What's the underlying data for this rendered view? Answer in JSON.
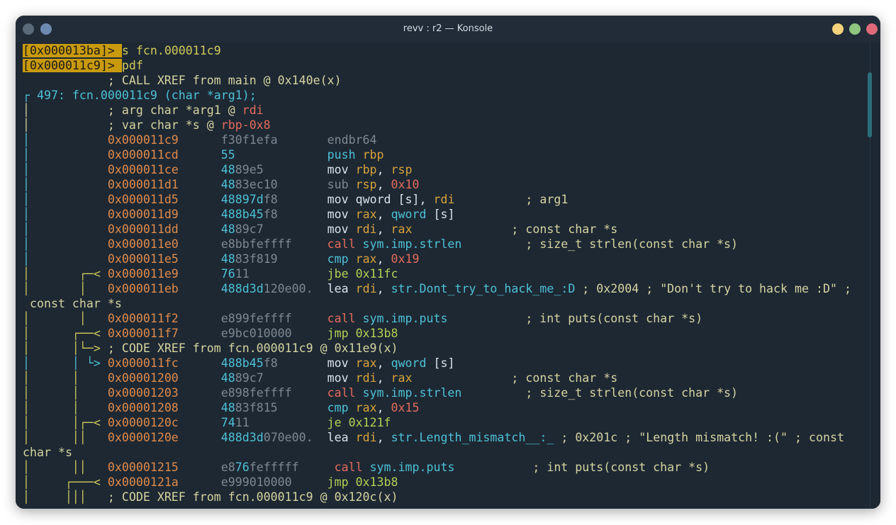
{
  "window": {
    "title": "revv : r2 — Konsole"
  },
  "colors": {
    "bg": "#1d2833",
    "prompt_bg": "#c99a0e",
    "addr": "#e08a4a",
    "cyan": "#4ec1d6",
    "yellow": "#d1c95a",
    "white": "#dbe3ea",
    "gray": "#7d8892",
    "red": "#e46a5a",
    "orange": "#d9a23a",
    "green": "#b5cf54",
    "blue": "#58a8e0",
    "comment": "#d6d4a0"
  },
  "lines": [
    [
      {
        "t": "[0x000013ba]> ",
        "c": "prompt"
      },
      {
        "t": "s fcn.000011c9",
        "c": "yellow"
      }
    ],
    [
      {
        "t": "[0x000011c9]> ",
        "c": "prompt"
      },
      {
        "t": "pdf",
        "c": "yellow"
      }
    ],
    [
      {
        "t": "            ; CALL XREF from main @ 0x140e(x)",
        "c": "comment"
      }
    ],
    [
      {
        "t": "┌ 497: fcn.000011c9 (char *arg1);",
        "c": "cyan"
      }
    ],
    [
      {
        "t": "│           ; arg char *arg1 @ ",
        "c": "comment"
      },
      {
        "t": "rdi",
        "c": "red"
      }
    ],
    [
      {
        "t": "│           ; var char *s @ ",
        "c": "comment"
      },
      {
        "t": "rbp-0x8",
        "c": "red"
      }
    ],
    [
      {
        "t": "│           ",
        "c": "cyan"
      },
      {
        "t": "0x000011c9",
        "c": "addr"
      },
      {
        "t": "      f30f1efa       ",
        "c": "gray"
      },
      {
        "t": "endbr64",
        "c": "gray"
      }
    ],
    [
      {
        "t": "│           ",
        "c": "cyan"
      },
      {
        "t": "0x000011cd",
        "c": "addr"
      },
      {
        "t": "      ",
        "c": "gray"
      },
      {
        "t": "55",
        "c": "cyan"
      },
      {
        "t": "             ",
        "c": "gray"
      },
      {
        "t": "push ",
        "c": "cyan"
      },
      {
        "t": "rbp",
        "c": "orange"
      }
    ],
    [
      {
        "t": "│           ",
        "c": "cyan"
      },
      {
        "t": "0x000011ce",
        "c": "addr"
      },
      {
        "t": "      ",
        "c": "gray"
      },
      {
        "t": "48",
        "c": "cyan"
      },
      {
        "t": "89e5         ",
        "c": "gray"
      },
      {
        "t": "mov ",
        "c": "white"
      },
      {
        "t": "rbp",
        "c": "orange"
      },
      {
        "t": ", ",
        "c": "white"
      },
      {
        "t": "rsp",
        "c": "orange"
      }
    ],
    [
      {
        "t": "│           ",
        "c": "cyan"
      },
      {
        "t": "0x000011d1",
        "c": "addr"
      },
      {
        "t": "      ",
        "c": "gray"
      },
      {
        "t": "48",
        "c": "cyan"
      },
      {
        "t": "83ec10       ",
        "c": "gray"
      },
      {
        "t": "sub ",
        "c": "gray"
      },
      {
        "t": "rsp",
        "c": "orange"
      },
      {
        "t": ", ",
        "c": "white"
      },
      {
        "t": "0x10",
        "c": "red"
      }
    ],
    [
      {
        "t": "│           ",
        "c": "cyan"
      },
      {
        "t": "0x000011d5",
        "c": "addr"
      },
      {
        "t": "      ",
        "c": "gray"
      },
      {
        "t": "48897d",
        "c": "cyan"
      },
      {
        "t": "f8       ",
        "c": "gray"
      },
      {
        "t": "mov ",
        "c": "white"
      },
      {
        "t": "qword ",
        "c": "white"
      },
      {
        "t": "[s]",
        "c": "white"
      },
      {
        "t": ", ",
        "c": "white"
      },
      {
        "t": "rdi",
        "c": "orange"
      },
      {
        "t": "          ; arg1",
        "c": "comment"
      }
    ],
    [
      {
        "t": "│           ",
        "c": "cyan"
      },
      {
        "t": "0x000011d9",
        "c": "addr"
      },
      {
        "t": "      ",
        "c": "gray"
      },
      {
        "t": "488b45",
        "c": "cyan"
      },
      {
        "t": "f8       ",
        "c": "gray"
      },
      {
        "t": "mov ",
        "c": "white"
      },
      {
        "t": "rax",
        "c": "orange"
      },
      {
        "t": ", ",
        "c": "white"
      },
      {
        "t": "qword ",
        "c": "cyan"
      },
      {
        "t": "[s]",
        "c": "white"
      }
    ],
    [
      {
        "t": "│           ",
        "c": "cyan"
      },
      {
        "t": "0x000011dd",
        "c": "addr"
      },
      {
        "t": "      ",
        "c": "gray"
      },
      {
        "t": "48",
        "c": "cyan"
      },
      {
        "t": "89c7         ",
        "c": "gray"
      },
      {
        "t": "mov ",
        "c": "white"
      },
      {
        "t": "rdi",
        "c": "orange"
      },
      {
        "t": ", ",
        "c": "white"
      },
      {
        "t": "rax",
        "c": "orange"
      },
      {
        "t": "              ; const char *s",
        "c": "comment"
      }
    ],
    [
      {
        "t": "│           ",
        "c": "cyan"
      },
      {
        "t": "0x000011e0",
        "c": "addr"
      },
      {
        "t": "      e8bbfeffff     ",
        "c": "gray"
      },
      {
        "t": "call ",
        "c": "red"
      },
      {
        "t": "sym.imp.strlen",
        "c": "cyan"
      },
      {
        "t": "         ; size_t strlen(const char *s)",
        "c": "comment"
      }
    ],
    [
      {
        "t": "│           ",
        "c": "cyan"
      },
      {
        "t": "0x000011e5",
        "c": "addr"
      },
      {
        "t": "      ",
        "c": "gray"
      },
      {
        "t": "48",
        "c": "cyan"
      },
      {
        "t": "83f819       ",
        "c": "gray"
      },
      {
        "t": "cmp ",
        "c": "cyan"
      },
      {
        "t": "rax",
        "c": "orange"
      },
      {
        "t": ", ",
        "c": "white"
      },
      {
        "t": "0x19",
        "c": "red"
      }
    ],
    [
      {
        "t": "│       ┌─< ",
        "c": "yellow"
      },
      {
        "t": "0x000011e9",
        "c": "addr"
      },
      {
        "t": "      ",
        "c": "gray"
      },
      {
        "t": "76",
        "c": "cyan"
      },
      {
        "t": "11           ",
        "c": "gray"
      },
      {
        "t": "jbe ",
        "c": "green"
      },
      {
        "t": "0x11fc",
        "c": "green"
      }
    ],
    [
      {
        "t": "│       │   ",
        "c": "yellow"
      },
      {
        "t": "0x000011eb",
        "c": "addr"
      },
      {
        "t": "      ",
        "c": "gray"
      },
      {
        "t": "488d3d",
        "c": "cyan"
      },
      {
        "t": "120e00.  ",
        "c": "gray"
      },
      {
        "t": "lea ",
        "c": "white"
      },
      {
        "t": "rdi",
        "c": "orange"
      },
      {
        "t": ", ",
        "c": "white"
      },
      {
        "t": "str.Dont_try_to_hack_me_:D",
        "c": "cyan"
      },
      {
        "t": " ; 0x2004 ; \"Don't try to hack me :D\" ;",
        "c": "comment"
      }
    ],
    [
      {
        "t": " const char *s",
        "c": "comment"
      }
    ],
    [
      {
        "t": "│       │   ",
        "c": "yellow"
      },
      {
        "t": "0x000011f2",
        "c": "addr"
      },
      {
        "t": "      e899feffff     ",
        "c": "gray"
      },
      {
        "t": "call ",
        "c": "red"
      },
      {
        "t": "sym.imp.puts",
        "c": "cyan"
      },
      {
        "t": "           ; int puts(const char *s)",
        "c": "comment"
      }
    ],
    [
      {
        "t": "│      ┌──< ",
        "c": "yellow"
      },
      {
        "t": "0x000011f7",
        "c": "addr"
      },
      {
        "t": "      e9bc010000     ",
        "c": "gray"
      },
      {
        "t": "jmp ",
        "c": "green"
      },
      {
        "t": "0x13b8",
        "c": "green"
      }
    ],
    [
      {
        "t": "│      │└─> ",
        "c": "yellow"
      },
      {
        "t": "; CODE XREF from fcn.000011c9 @ 0x11e9(x)",
        "c": "comment"
      }
    ],
    [
      {
        "t": "│      │ └> ",
        "c": "cyan"
      },
      {
        "t": "0x000011fc",
        "c": "addr"
      },
      {
        "t": "      ",
        "c": "gray"
      },
      {
        "t": "488b45",
        "c": "cyan"
      },
      {
        "t": "f8       ",
        "c": "gray"
      },
      {
        "t": "mov ",
        "c": "white"
      },
      {
        "t": "rax",
        "c": "orange"
      },
      {
        "t": ", ",
        "c": "white"
      },
      {
        "t": "qword ",
        "c": "cyan"
      },
      {
        "t": "[s]",
        "c": "white"
      }
    ],
    [
      {
        "t": "│      │    ",
        "c": "yellow"
      },
      {
        "t": "0x00001200",
        "c": "addr"
      },
      {
        "t": "      ",
        "c": "gray"
      },
      {
        "t": "48",
        "c": "cyan"
      },
      {
        "t": "89c7         ",
        "c": "gray"
      },
      {
        "t": "mov ",
        "c": "white"
      },
      {
        "t": "rdi",
        "c": "orange"
      },
      {
        "t": ", ",
        "c": "white"
      },
      {
        "t": "rax",
        "c": "orange"
      },
      {
        "t": "              ; const char *s",
        "c": "comment"
      }
    ],
    [
      {
        "t": "│      │    ",
        "c": "yellow"
      },
      {
        "t": "0x00001203",
        "c": "addr"
      },
      {
        "t": "      e898feffff     ",
        "c": "gray"
      },
      {
        "t": "call ",
        "c": "red"
      },
      {
        "t": "sym.imp.strlen",
        "c": "cyan"
      },
      {
        "t": "         ; size_t strlen(const char *s)",
        "c": "comment"
      }
    ],
    [
      {
        "t": "│      │    ",
        "c": "yellow"
      },
      {
        "t": "0x00001208",
        "c": "addr"
      },
      {
        "t": "      ",
        "c": "gray"
      },
      {
        "t": "48",
        "c": "cyan"
      },
      {
        "t": "83f815       ",
        "c": "gray"
      },
      {
        "t": "cmp ",
        "c": "cyan"
      },
      {
        "t": "rax",
        "c": "orange"
      },
      {
        "t": ", ",
        "c": "white"
      },
      {
        "t": "0x15",
        "c": "red"
      }
    ],
    [
      {
        "t": "│      │┌─< ",
        "c": "yellow"
      },
      {
        "t": "0x0000120c",
        "c": "addr"
      },
      {
        "t": "      ",
        "c": "gray"
      },
      {
        "t": "74",
        "c": "cyan"
      },
      {
        "t": "11           ",
        "c": "gray"
      },
      {
        "t": "je ",
        "c": "green"
      },
      {
        "t": "0x121f",
        "c": "green"
      }
    ],
    [
      {
        "t": "│      ││   ",
        "c": "yellow"
      },
      {
        "t": "0x0000120e",
        "c": "addr"
      },
      {
        "t": "      ",
        "c": "gray"
      },
      {
        "t": "488d3d",
        "c": "cyan"
      },
      {
        "t": "070e00.  ",
        "c": "gray"
      },
      {
        "t": "lea ",
        "c": "white"
      },
      {
        "t": "rdi",
        "c": "orange"
      },
      {
        "t": ", ",
        "c": "white"
      },
      {
        "t": "str.Length_mismatch__:_",
        "c": "cyan"
      },
      {
        "t": " ; 0x201c ; \"Length mismatch! :(\" ; const",
        "c": "comment"
      }
    ],
    [
      {
        "t": "char *s",
        "c": "comment"
      }
    ],
    [
      {
        "t": "│      ││   ",
        "c": "yellow"
      },
      {
        "t": "0x00001215",
        "c": "addr"
      },
      {
        "t": "      e8",
        "c": "gray"
      },
      {
        "t": "76",
        "c": "cyan"
      },
      {
        "t": "fefffff     ",
        "c": "gray"
      },
      {
        "t": "call ",
        "c": "red"
      },
      {
        "t": "sym.imp.puts",
        "c": "cyan"
      },
      {
        "t": "           ; int puts(const char *s)",
        "c": "comment"
      }
    ],
    [
      {
        "t": "│     ┌───< ",
        "c": "yellow"
      },
      {
        "t": "0x0000121a",
        "c": "addr"
      },
      {
        "t": "      e999010000     ",
        "c": "gray"
      },
      {
        "t": "jmp ",
        "c": "green"
      },
      {
        "t": "0x13b8",
        "c": "green"
      }
    ],
    [
      {
        "t": "│     │││   ",
        "c": "yellow"
      },
      {
        "t": "; CODE XREF from fcn.000011c9 @ 0x120c(x)",
        "c": "comment"
      }
    ]
  ]
}
